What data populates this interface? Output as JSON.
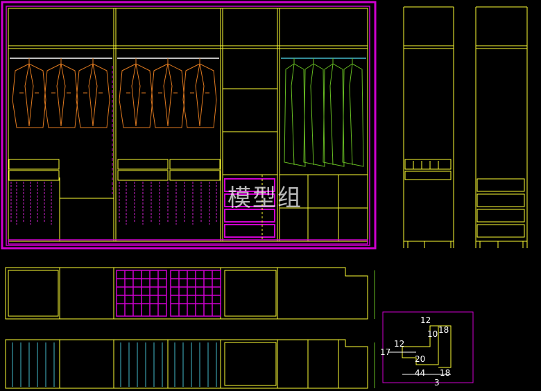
{
  "watermark": "模型组",
  "detail_dimensions": [
    "12",
    "18",
    "10",
    "12",
    "17",
    "20",
    "44",
    "3",
    "18"
  ],
  "colors": {
    "background": "#000000",
    "frame": "#d000d0",
    "cabinet": "#ffff33",
    "jacket": "#e07a20",
    "coat": "#66bb22",
    "pants": "#cc22cc",
    "door_blue": "#44bbcc",
    "dimension": "#ffffff"
  }
}
